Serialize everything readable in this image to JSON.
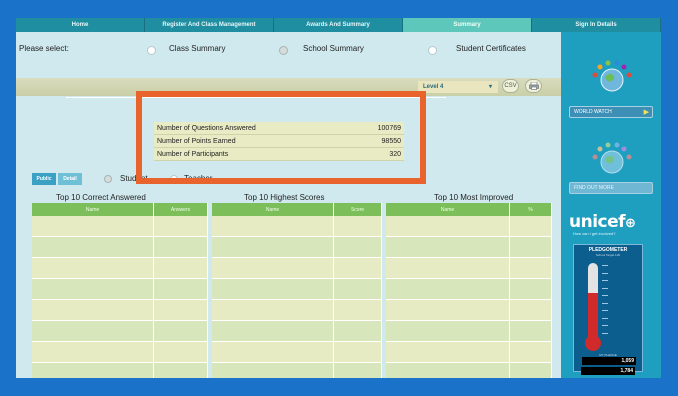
{
  "nav": {
    "tabs": [
      {
        "label": "Home",
        "active": false
      },
      {
        "label": "Register And Class Management",
        "active": false
      },
      {
        "label": "Awards And Summary",
        "active": false
      },
      {
        "label": "Summary",
        "active": true
      },
      {
        "label": "Sign In Details",
        "active": false
      }
    ]
  },
  "select": {
    "prompt": "Please select:",
    "options": [
      {
        "label": "Class Summary",
        "selected": false
      },
      {
        "label": "School Summary",
        "selected": true
      },
      {
        "label": "Student Certificates",
        "selected": false
      }
    ]
  },
  "toolbar": {
    "level": "Level 4",
    "csv_label": "CSV",
    "print_icon": "print-icon"
  },
  "summary": {
    "rows": [
      {
        "label": "Number of Questions Answered",
        "value": "100769"
      },
      {
        "label": "Number of Points Earned",
        "value": "98550"
      },
      {
        "label": "Number of Participants",
        "value": "320"
      }
    ]
  },
  "view": {
    "tabs": [
      "Public",
      "Detail"
    ],
    "who": [
      "Student",
      "Teacher"
    ]
  },
  "tables": {
    "correct": {
      "title": "Top 10 Correct Answered",
      "cols": [
        "Name",
        "Answers"
      ]
    },
    "scores": {
      "title": "Top 10 Highest Scores",
      "cols": [
        "Name",
        "Score"
      ]
    },
    "improved": {
      "title": "Top 10 Most Improved",
      "cols": [
        "Name",
        "%"
      ]
    }
  },
  "sidebar": {
    "btn1": "WORLD WATCH",
    "btn2": "FIND OUT MORE",
    "unicef": "unicef",
    "unicef_sub": "How can I get involved?",
    "pledge_title": "PLEDGOMETER",
    "pledge_sub": "School Target 100",
    "fill_fraction": 0.62,
    "count1_label": "MY PLEDGE",
    "count1": "1,059",
    "count2_label": "TOTAL PLEDGE",
    "count2": "1,784"
  },
  "colors": {
    "accent": "#1a73c8",
    "highlight": "#e8642c",
    "table_header": "#7cbf5a"
  }
}
